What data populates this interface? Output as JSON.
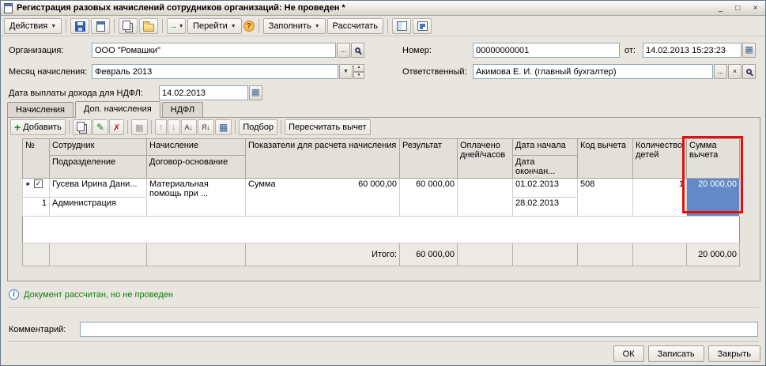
{
  "window": {
    "title": "Регистрация разовых начислений сотрудников организаций: Не проведен *"
  },
  "icons": {
    "minimize": "_",
    "maximize": "□",
    "close": "×",
    "dropdown": "▼",
    "ellipsis": "...",
    "clear": "×",
    "calendar": "▦",
    "spin_up": "▲",
    "spin_down": "▼",
    "help": "?",
    "add": "+",
    "edit": "✎",
    "delete": "✗",
    "move_up": "↑",
    "move_down": "↓",
    "sort_asc": "А↓",
    "sort_desc": "Я↓",
    "grid": "▦",
    "info": "i",
    "marker": "►",
    "check": "✓",
    "go_arrow": "→"
  },
  "toolbar": {
    "actions": "Действия",
    "go": "Перейти",
    "fill": "Заполнить",
    "calculate": "Рассчитать"
  },
  "form": {
    "organization_label": "Организация:",
    "organization_value": "ООО \"Ромашки\"",
    "number_label": "Номер:",
    "number_value": "00000000001",
    "date_label": "от:",
    "date_value": "14.02.2013 15:23:23",
    "month_label": "Месяц начисления:",
    "month_value": "Февраль 2013",
    "responsible_label": "Ответственный:",
    "responsible_value": "Акимова Е. И. (главный бухгалтер)",
    "ndfl_label": "Дата выплаты дохода для НДФЛ:",
    "ndfl_value": "14.02.2013"
  },
  "tabs": [
    {
      "label": "Начисления"
    },
    {
      "label": "Доп. начисления"
    },
    {
      "label": "НДФЛ"
    }
  ],
  "grid_toolbar": {
    "add": "Добавить",
    "pick": "Подбор",
    "recalc": "Пересчитать вычет"
  },
  "grid": {
    "columns": {
      "num": "№",
      "employee": "Сотрудник",
      "department": "Подразделение",
      "accrual": "Начисление",
      "contract": "Договор-основание",
      "indicators": "Показатели для расчета начисления",
      "result": "Результат",
      "paid": "Оплачено дней/часов",
      "date_start": "Дата начала",
      "date_end": "Дата окончан...",
      "code": "Код вычета",
      "children": "Количество детей",
      "deduction": "Сумма вычета"
    },
    "row": {
      "num": "1",
      "employee": "Гусева Ирина Дани...",
      "department": "Администрация",
      "accrual": "Материальная помощь при ...",
      "indicator_name": "Сумма",
      "indicator_value": "60 000,00",
      "result": "60 000,00",
      "date_start": "01.02.2013",
      "date_end": "28.02.2013",
      "code": "508",
      "children": "1",
      "deduction": "20 000,00"
    },
    "footer": {
      "label": "Итого:",
      "result": "60 000,00",
      "deduction": "20 000,00"
    }
  },
  "status": {
    "text": "Документ рассчитан, но не проведен"
  },
  "comment": {
    "label": "Комментарий:",
    "value": ""
  },
  "footer_buttons": {
    "ok": "ОК",
    "save": "Записать",
    "close": "Закрыть"
  },
  "colors": {
    "selection": "#638ac6",
    "annotation": "#e01010",
    "status_green": "#0f7d0f"
  }
}
